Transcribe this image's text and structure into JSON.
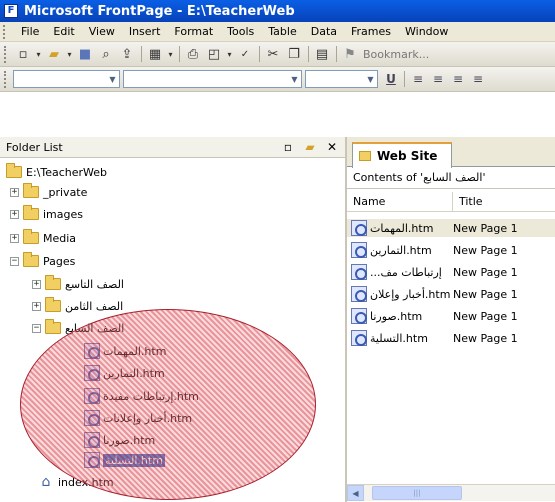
{
  "window": {
    "title": "Microsoft FrontPage - E:\\TeacherWeb"
  },
  "menubar": {
    "items": [
      "File",
      "Edit",
      "View",
      "Insert",
      "Format",
      "Tools",
      "Table",
      "Data",
      "Frames",
      "Window"
    ]
  },
  "toolbar": {
    "bookmark_label": "Bookmark..."
  },
  "folder_list": {
    "header": "Folder List",
    "root": "E:\\TeacherWeb",
    "items": {
      "private": "_private",
      "images": "images",
      "media": "Media",
      "pages": "Pages",
      "grade9": "الصف التاسع",
      "grade8": "الصف الثامن",
      "grade7": "الصف السابع",
      "file1": "المهمات.htm",
      "file2": "التمارين.htm",
      "file3": "إرتباطات مفيدة.htm",
      "file4": "أخبار وإعلانات.htm",
      "file5": "صورنا.htm",
      "file6": "التسلية.htm",
      "index": "index.htm"
    }
  },
  "site_pane": {
    "tab_label": "Web Site",
    "contents_label": "Contents of 'الصف السابع'",
    "columns": {
      "name": "Name",
      "title": "Title"
    },
    "rows": [
      {
        "name": "المهمات.htm",
        "title": "New Page 1"
      },
      {
        "name": "التمارين.htm",
        "title": "New Page 1"
      },
      {
        "name": "...إرتباطات مف",
        "title": "New Page 1"
      },
      {
        "name": "أخبار وإعلان.htm",
        "title": "New Page 1"
      },
      {
        "name": "صورنا.htm",
        "title": "New Page 1"
      },
      {
        "name": "التسلية.htm",
        "title": "New Page 1"
      }
    ]
  }
}
